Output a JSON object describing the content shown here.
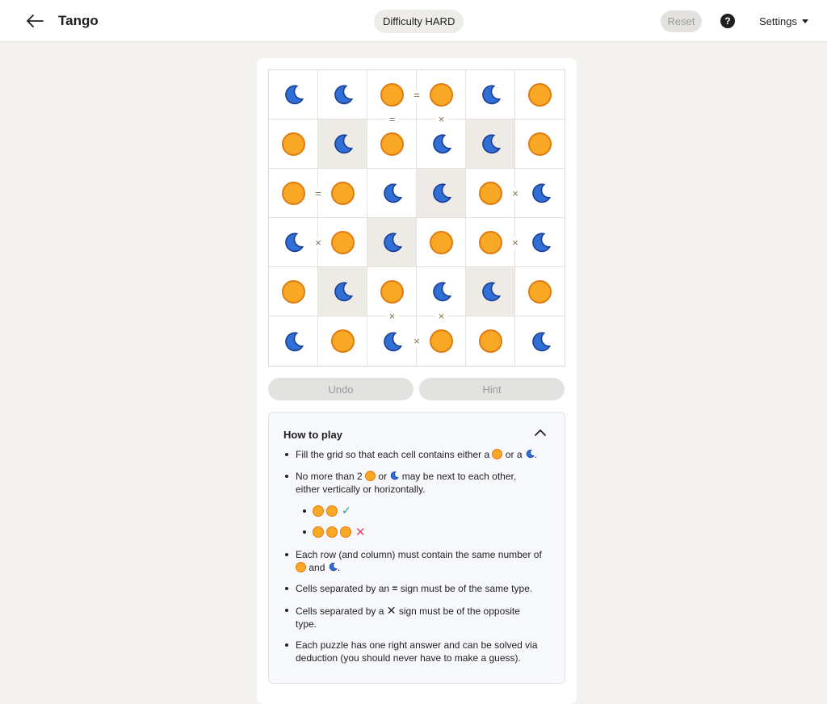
{
  "header": {
    "title": "Tango",
    "difficulty": "Difficulty HARD",
    "reset_label": "Reset",
    "help_label": "?",
    "settings_label": "Settings"
  },
  "colors": {
    "sun_fill": "#f9a825",
    "sun_stroke": "#e07b12",
    "moon_fill": "#2f6fd6",
    "moon_stroke": "#1b3f94",
    "locked_cell_bg": "#eeebe6",
    "sign_color": "#8a6d4b"
  },
  "board": {
    "size": 6,
    "rows": [
      [
        "moon",
        "moon",
        "sun",
        "sun",
        "moon",
        "sun"
      ],
      [
        "sun",
        "moon",
        "sun",
        "moon",
        "moon",
        "sun"
      ],
      [
        "sun",
        "sun",
        "moon",
        "moon",
        "sun",
        "moon"
      ],
      [
        "moon",
        "sun",
        "moon",
        "sun",
        "sun",
        "moon"
      ],
      [
        "sun",
        "moon",
        "sun",
        "moon",
        "moon",
        "sun"
      ],
      [
        "moon",
        "sun",
        "moon",
        "sun",
        "sun",
        "moon"
      ]
    ],
    "locked": [
      [
        1,
        1
      ],
      [
        1,
        4
      ],
      [
        2,
        3
      ],
      [
        3,
        2
      ],
      [
        4,
        1
      ],
      [
        4,
        4
      ]
    ],
    "horizontal_signs": [
      {
        "row": 0,
        "between": [
          2,
          3
        ],
        "symbol": "="
      },
      {
        "row": 2,
        "between": [
          0,
          1
        ],
        "symbol": "="
      },
      {
        "row": 2,
        "between": [
          4,
          5
        ],
        "symbol": "×"
      },
      {
        "row": 3,
        "between": [
          0,
          1
        ],
        "symbol": "×"
      },
      {
        "row": 3,
        "between": [
          4,
          5
        ],
        "symbol": "×"
      },
      {
        "row": 5,
        "between": [
          2,
          3
        ],
        "symbol": "×"
      }
    ],
    "vertical_signs": [
      {
        "col": 2,
        "between": [
          0,
          1
        ],
        "symbol": "="
      },
      {
        "col": 3,
        "between": [
          0,
          1
        ],
        "symbol": "×"
      },
      {
        "col": 2,
        "between": [
          4,
          5
        ],
        "symbol": "×"
      },
      {
        "col": 3,
        "between": [
          4,
          5
        ],
        "symbol": "×"
      }
    ]
  },
  "actions": {
    "undo_label": "Undo",
    "hint_label": "Hint"
  },
  "how_to_play": {
    "title": "How to play",
    "rule1_a": "Fill the grid so that each cell contains either a",
    "rule1_b": "or a",
    "rule1_c": ".",
    "rule2_a": "No more than 2",
    "rule2_b": "or",
    "rule2_c": "may be next to each other,",
    "rule2_d": "either vertically or horizontally.",
    "example_ok": "✓",
    "example_bad": "✕",
    "rule3_a": "Each row (and column) must contain the same number of",
    "rule3_b": "and",
    "rule3_c": ".",
    "rule4_a": "Cells separated by an",
    "rule4_sym": "=",
    "rule4_b": "sign must be of the same type.",
    "rule5_a": "Cells separated by a",
    "rule5_sym": "✕",
    "rule5_b": "sign must be of the opposite",
    "rule5_c": "type.",
    "rule6_a": "Each puzzle has one right answer and can be solved via",
    "rule6_b": "deduction (you should never have to make a guess)."
  }
}
